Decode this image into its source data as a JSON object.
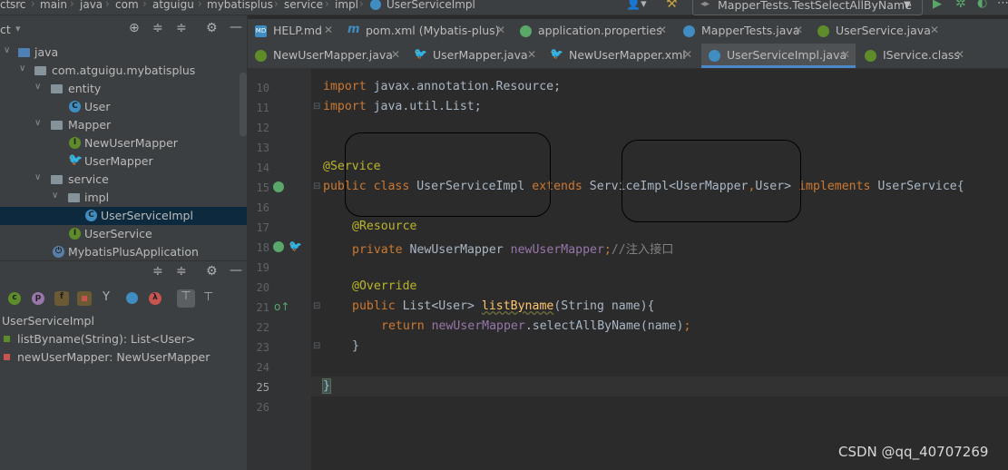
{
  "breadcrumb": [
    "ct",
    "src",
    "main",
    "java",
    "com",
    "atguigu",
    "mybatisplus",
    "service",
    "impl",
    "UserServiceImpl"
  ],
  "run_config": {
    "label": "MapperTests.TestSelectAllByName"
  },
  "project_tree": [
    {
      "label": "java",
      "icon": "folder-icon",
      "expanded": true
    },
    {
      "label": "com.atguigu.mybatisplus",
      "icon": "package-icon",
      "expanded": true
    },
    {
      "label": "entity",
      "icon": "package-icon",
      "expanded": true
    },
    {
      "label": "User",
      "icon": "class-icon"
    },
    {
      "label": "Mapper",
      "icon": "package-icon",
      "expanded": true
    },
    {
      "label": "NewUserMapper",
      "icon": "interface-icon"
    },
    {
      "label": "UserMapper",
      "icon": "mybatis-icon"
    },
    {
      "label": "service",
      "icon": "package-icon",
      "expanded": true
    },
    {
      "label": "impl",
      "icon": "package-icon",
      "expanded": true
    },
    {
      "label": "UserServiceImpl",
      "icon": "class-icon",
      "selected": true
    },
    {
      "label": "UserService",
      "icon": "interface-icon"
    },
    {
      "label": "MybatisPlusApplication",
      "icon": "springboot-icon"
    }
  ],
  "structure": {
    "root": "UserServiceImpl",
    "items": [
      "listByname(String): List<User>",
      "newUserMapper: NewUserMapper"
    ]
  },
  "tabs_row1": [
    {
      "label": "HELP.md",
      "icon": "markdown-icon"
    },
    {
      "label": "pom.xml (Mybatis-plus)",
      "icon": "maven-icon"
    },
    {
      "label": "application.properties",
      "icon": "properties-icon"
    },
    {
      "label": "MapperTests.java",
      "icon": "class-icon"
    },
    {
      "label": "UserService.java",
      "icon": "interface-icon"
    }
  ],
  "tabs_row2": [
    {
      "label": "NewUserMapper.java",
      "icon": "interface-icon"
    },
    {
      "label": "UserMapper.java",
      "icon": "mybatis-icon"
    },
    {
      "label": "NewUserMapper.xml",
      "icon": "mybatis-icon"
    },
    {
      "label": "UserServiceImpl.java",
      "icon": "class-icon",
      "active": true
    },
    {
      "label": "IService.class",
      "icon": "interface-icon"
    }
  ],
  "line_numbers": [
    "10",
    "11",
    "12",
    "13",
    "14",
    "15",
    "16",
    "17",
    "18",
    "19",
    "20",
    "21",
    "22",
    "23",
    "24",
    "25",
    "26"
  ],
  "code": {
    "l10_kw": "import",
    "l10_rest": " javax.annotation.Resource;",
    "l11_kw": "import",
    "l11_rest": " java.util.List;",
    "l14_an": "@Service",
    "l15_kw1": "public class",
    "l15_a": " UserServiceImpl ",
    "l15_kw2": "extends",
    "l15_b": " ServiceImpl<UserMapper",
    "l15_c": ",",
    "l15_d": "User> ",
    "l15_kw3": "implements",
    "l15_e": " UserService{",
    "l17_an": "@Resource",
    "l18_kw": "private",
    "l18_a": " NewUserMapper ",
    "l18_fd": "newUserMapper",
    "l18_sc": ";",
    "l18_cm": "//注入接口",
    "l20_an": "@Override",
    "l21_kw": "public",
    "l21_a": " List<User> ",
    "l21_fn": "listByname",
    "l21_b": "(String name){",
    "l22_kw": "return",
    "l22_fd": "newUserMapper",
    "l22_a": ".selectAllByName(name)",
    "l22_sc": ";",
    "l23": "}",
    "l25": "}"
  },
  "watermark": "CSDN @qq_40707269"
}
